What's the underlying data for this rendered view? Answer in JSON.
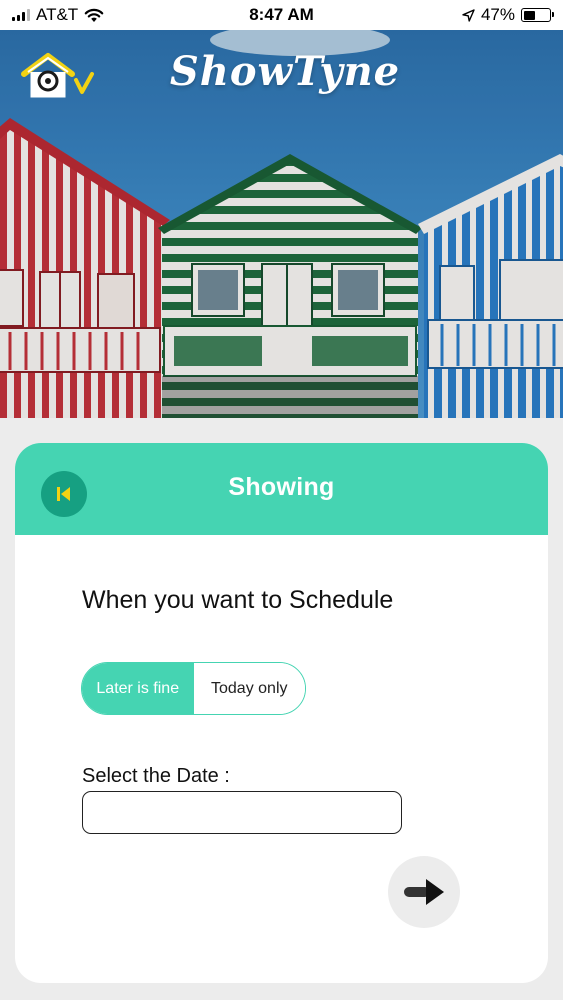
{
  "status_bar": {
    "carrier": "AT&T",
    "time": "8:47 AM",
    "battery_percent": "47%",
    "battery_level": 0.47,
    "icons": [
      "signal-icon",
      "wifi-icon",
      "location-arrow-icon",
      "battery-icon"
    ]
  },
  "header": {
    "brand": "ShowTyne",
    "logo_icon": "home-check-icon"
  },
  "card": {
    "title": "Showing",
    "back_icon": "skip-back-icon",
    "prompt": "When you want to Schedule",
    "toggle": {
      "options": [
        "Later is fine",
        "Today only"
      ],
      "selected": "Later is fine"
    },
    "date_label": "Select the Date :",
    "date_value": "",
    "next_icon": "arrow-right-icon"
  },
  "colors": {
    "accent": "#45d4b2",
    "accent_dark": "#16a082",
    "back_arrow": "#f2d214",
    "page_bg": "#ececec"
  }
}
